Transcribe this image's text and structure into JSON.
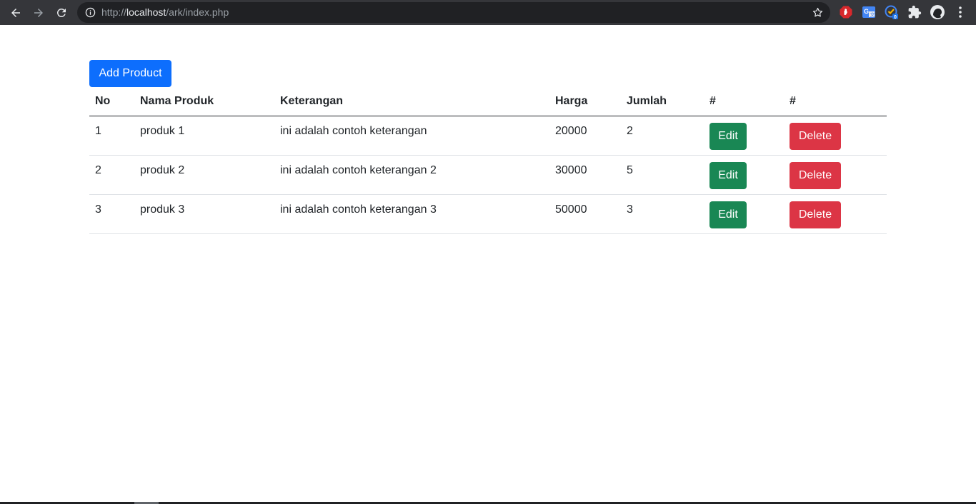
{
  "browser": {
    "url_scheme": "http://",
    "url_host": "localhost",
    "url_path": "/ark/index.php"
  },
  "page": {
    "add_button_label": "Add Product",
    "headers": [
      "No",
      "Nama Produk",
      "Keterangan",
      "Harga",
      "Jumlah",
      "#",
      "#"
    ],
    "rows": [
      {
        "no": "1",
        "nama": "produk 1",
        "keterangan": "ini adalah contoh keterangan",
        "harga": "20000",
        "jumlah": "2",
        "edit": "Edit",
        "delete": "Delete"
      },
      {
        "no": "2",
        "nama": "produk 2",
        "keterangan": "ini adalah contoh keterangan 2",
        "harga": "30000",
        "jumlah": "5",
        "edit": "Edit",
        "delete": "Delete"
      },
      {
        "no": "3",
        "nama": "produk 3",
        "keterangan": "ini adalah contoh keterangan 3",
        "harga": "50000",
        "jumlah": "3",
        "edit": "Edit",
        "delete": "Delete"
      }
    ]
  },
  "colors": {
    "primary": "#0d6efd",
    "success": "#198754",
    "danger": "#dc3545",
    "chrome_bg": "#35363a"
  }
}
